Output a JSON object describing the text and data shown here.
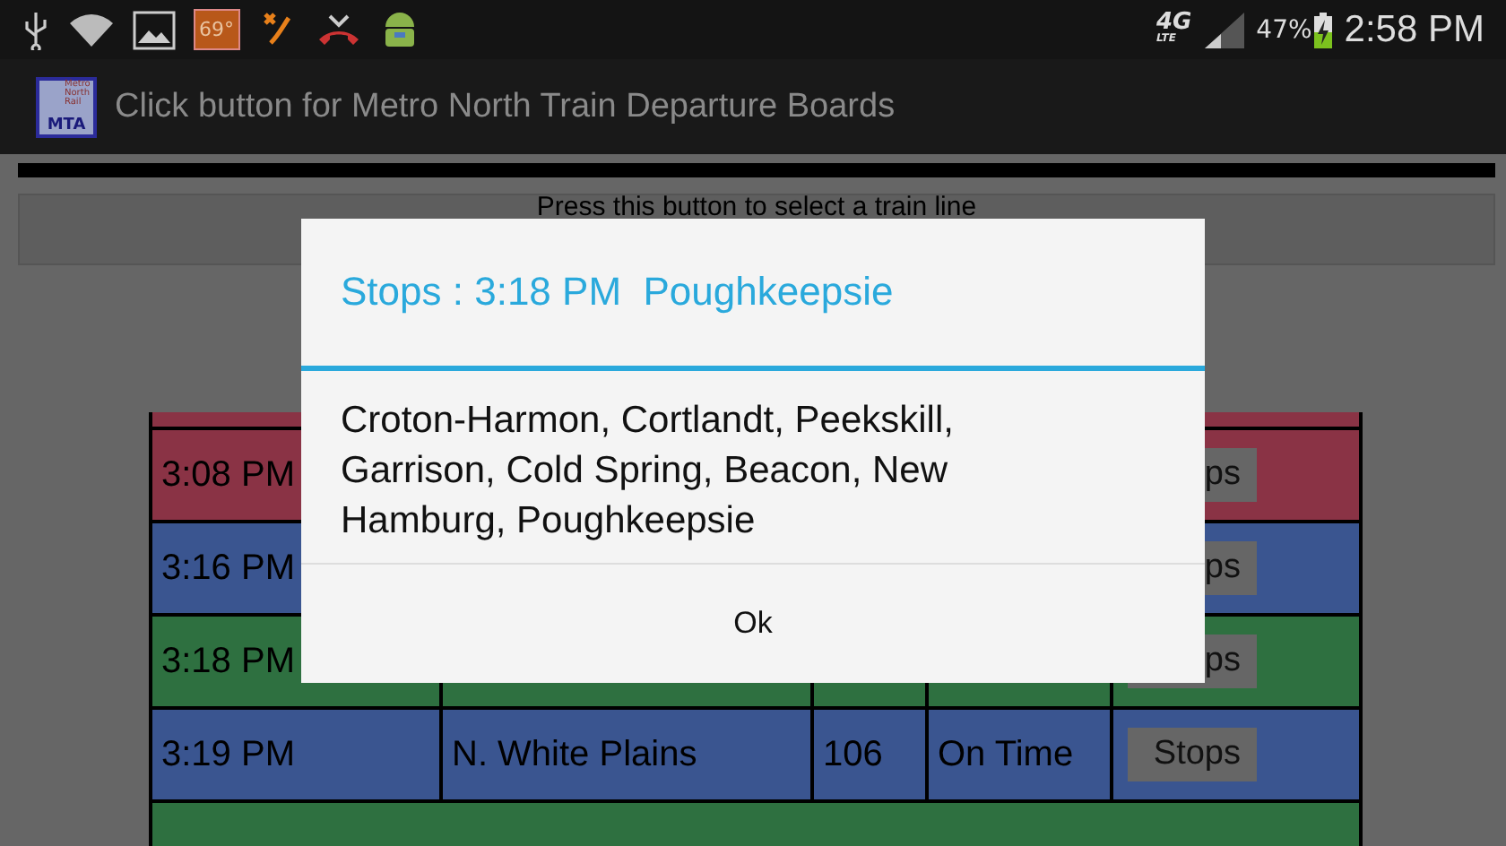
{
  "status_bar": {
    "temperature": "69°",
    "network": "4G",
    "network_sub": "LTE",
    "battery": "47%",
    "time": "2:58 PM"
  },
  "action_bar": {
    "logo_top": "Metro North Rail",
    "logo_bottom": "MTA",
    "title": "Click button for Metro North Train Departure Boards"
  },
  "select_button": "Press this button to select a train line",
  "rows": [
    {
      "color": "#8a3345"
    },
    {
      "color": "#8a3345",
      "time": "3:08 PM",
      "button": "ps"
    },
    {
      "color": "#3a5590",
      "time": "3:16 PM",
      "button": "ps"
    },
    {
      "color": "#2e7040",
      "time": "3:18 PM",
      "button": "ps"
    },
    {
      "color": "#3a5590",
      "time": "3:19 PM",
      "destination": "N. White Plains",
      "track": "106",
      "status": "On Time",
      "button": "Stops"
    },
    {
      "color": "#2e7040"
    }
  ],
  "dialog": {
    "title": "Stops : 3:18 PM  Poughkeepsie",
    "message": "Croton-Harmon, Cortlandt, Peekskill, Garrison, Cold Spring, Beacon, New Hamburg, Poughkeepsie",
    "button": "Ok"
  }
}
